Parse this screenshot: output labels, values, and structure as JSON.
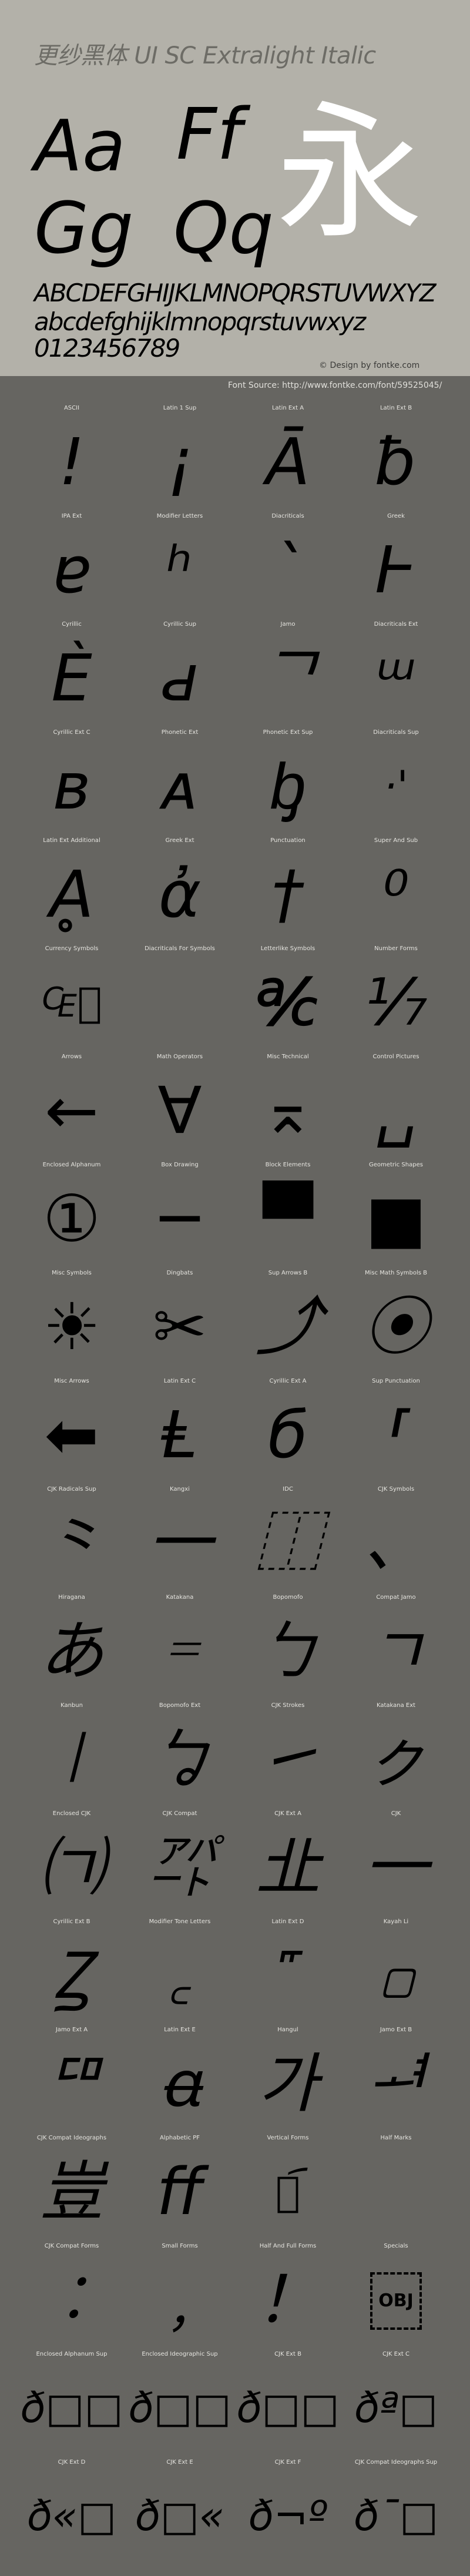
{
  "header": {
    "title": "更纱黑体 UI SC Extralight Italic",
    "sample_pairs": [
      "Aa",
      "Ff",
      "Gg",
      "Qq"
    ],
    "sample_cjk": "永",
    "uppercase": "ABCDEFGHIJKLMNOPQRSTUVWXYZ",
    "lowercase": "abcdefghijklmnopqrstuvwxyz",
    "digits": "0123456789",
    "credit": "© Design by fontke.com",
    "source": "Font Source: http://www.fontke.com/font/59525045/"
  },
  "colors": {
    "header_bg": "#b3b1a9",
    "body_bg": "#666561",
    "cjk_sample": "#ffffff",
    "glyph": "#000000"
  },
  "blocks": [
    {
      "label": "ASCII",
      "sample": "!"
    },
    {
      "label": "Latin 1 Sup",
      "sample": "¡"
    },
    {
      "label": "Latin Ext A",
      "sample": "Ā"
    },
    {
      "label": "Latin Ext B",
      "sample": "ƀ"
    },
    {
      "label": "IPA Ext",
      "sample": "ɐ"
    },
    {
      "label": "Modifier Letters",
      "sample": "ʰ"
    },
    {
      "label": "Diacriticals",
      "sample": "`"
    },
    {
      "label": "Greek",
      "sample": "Ͱ"
    },
    {
      "label": "Cyrillic",
      "sample": "Ѐ"
    },
    {
      "label": "Cyrillic Sup",
      "sample": "ԁ"
    },
    {
      "label": "Jamo",
      "sample": "ᄀ"
    },
    {
      "label": "Diacriticals Ext",
      "sample": "ᵚ"
    },
    {
      "label": "Cyrillic Ext C",
      "sample": "в"
    },
    {
      "label": "Phonetic Ext",
      "sample": "ᴀ"
    },
    {
      "label": "Phonetic Ext Sup",
      "sample": "ᶀ"
    },
    {
      "label": "Diacriticals Sup",
      "sample": "·'"
    },
    {
      "label": "Latin Ext Additional",
      "sample": "Ḁ"
    },
    {
      "label": "Greek Ext",
      "sample": "ἀ"
    },
    {
      "label": "Punctuation",
      "sample": "†"
    },
    {
      "label": "Super And Sub",
      "sample": "⁰"
    },
    {
      "label": "Currency Symbols",
      "sample": "₠⃝"
    },
    {
      "label": "Diacriticals For Symbols",
      "sample": ""
    },
    {
      "label": "Letterlike Symbols",
      "sample": "℀"
    },
    {
      "label": "Number Forms",
      "sample": "⅐"
    },
    {
      "label": "Arrows",
      "sample": "←"
    },
    {
      "label": "Math Operators",
      "sample": "∀"
    },
    {
      "label": "Misc Technical",
      "sample": "⌅"
    },
    {
      "label": "Control Pictures",
      "sample": "␣"
    },
    {
      "label": "Enclosed Alphanum",
      "sample": "①"
    },
    {
      "label": "Box Drawing",
      "sample": "─"
    },
    {
      "label": "Block Elements",
      "sample": "▀"
    },
    {
      "label": "Geometric Shapes",
      "sample": "■"
    },
    {
      "label": "Misc Symbols",
      "sample": "☀"
    },
    {
      "label": "Dingbats",
      "sample": "✂"
    },
    {
      "label": "Sup Arrows B",
      "sample": "⤴"
    },
    {
      "label": "Misc Math Symbols B",
      "sample": "⦿"
    },
    {
      "label": "Misc Arrows",
      "sample": "⬅"
    },
    {
      "label": "Latin Ext C",
      "sample": "Ⱡ"
    },
    {
      "label": "Cyrillic Ext A",
      "sample": "б"
    },
    {
      "label": "Sup Punctuation",
      "sample": "⸢"
    },
    {
      "label": "CJK Radicals Sup",
      "sample": "⺀"
    },
    {
      "label": "Kangxi",
      "sample": "⼀"
    },
    {
      "label": "IDC",
      "sample": "⿰"
    },
    {
      "label": "CJK Symbols",
      "sample": "、"
    },
    {
      "label": "Hiragana",
      "sample": "あ"
    },
    {
      "label": "Katakana",
      "sample": "゠"
    },
    {
      "label": "Bopomofo",
      "sample": "ㄅ"
    },
    {
      "label": "Compat Jamo",
      "sample": "ㄱ"
    },
    {
      "label": "Kanbun",
      "sample": "㆐"
    },
    {
      "label": "Bopomofo Ext",
      "sample": "ㆠ"
    },
    {
      "label": "CJK Strokes",
      "sample": "㇀"
    },
    {
      "label": "Katakana Ext",
      "sample": "ㇰ"
    },
    {
      "label": "Enclosed CJK",
      "sample": "㈀"
    },
    {
      "label": "CJK Compat",
      "sample": "㌀"
    },
    {
      "label": "CJK Ext A",
      "sample": "㐀"
    },
    {
      "label": "CJK",
      "sample": "一"
    },
    {
      "label": "Cyrillic Ext B",
      "sample": "Ꙁ"
    },
    {
      "label": "Modifier Tone Letters",
      "sample": "꜀"
    },
    {
      "label": "Latin Ext D",
      "sample": "꜠"
    },
    {
      "label": "Kayah Li",
      "sample": "꤀"
    },
    {
      "label": "Jamo Ext A",
      "sample": "ꥠ"
    },
    {
      "label": "Latin Ext E",
      "sample": "ꬰ"
    },
    {
      "label": "Hangul",
      "sample": "가"
    },
    {
      "label": "Jamo Ext B",
      "sample": "ힰ"
    },
    {
      "label": "CJK Compat Ideographs",
      "sample": "豈"
    },
    {
      "label": "Alphabetic PF",
      "sample": "ﬀ"
    },
    {
      "label": "Vertical Forms",
      "sample": "︔︠"
    },
    {
      "label": "Half Marks",
      "sample": ""
    },
    {
      "label": "CJK Compat Forms",
      "sample": "︰"
    },
    {
      "label": "Small Forms",
      "sample": "﹐"
    },
    {
      "label": "Half And Full Forms",
      "sample": "！"
    },
    {
      "label": "Specials",
      "sample": "OBJ"
    },
    {
      "label": "Enclosed Alphanum Sup",
      "sample": "ð□□"
    },
    {
      "label": "Enclosed Ideographic Sup",
      "sample": "ð□□"
    },
    {
      "label": "CJK Ext B",
      "sample": "ð□□"
    },
    {
      "label": "CJK Ext C",
      "sample": "ðª□"
    },
    {
      "label": "CJK Ext D",
      "sample": "ð«□"
    },
    {
      "label": "CJK Ext E",
      "sample": "ð□«"
    },
    {
      "label": "CJK Ext F",
      "sample": "ð¬º"
    },
    {
      "label": "CJK Compat Ideographs Sup",
      "sample": "ð¯□"
    }
  ]
}
